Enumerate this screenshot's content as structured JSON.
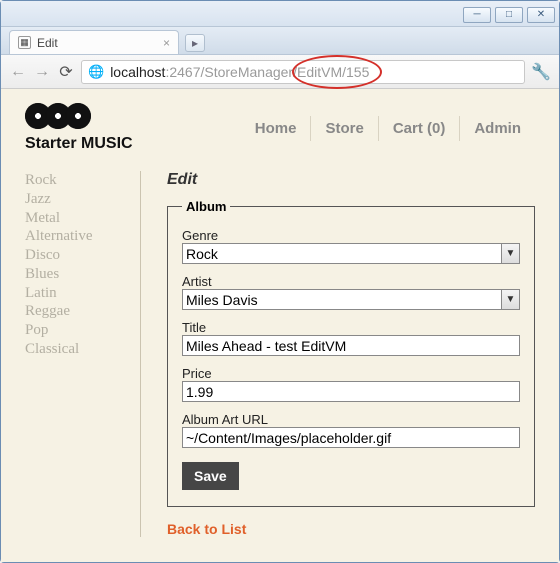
{
  "window": {
    "tab_title": "Edit",
    "url_host": "localhost",
    "url_rest": ":2467/StoreManager/EditVM/155"
  },
  "brand": "Starter MUSIC",
  "topnav": {
    "home": "Home",
    "store": "Store",
    "cart": "Cart (0)",
    "admin": "Admin"
  },
  "sidebar": {
    "genres": [
      "Rock",
      "Jazz",
      "Metal",
      "Alternative",
      "Disco",
      "Blues",
      "Latin",
      "Reggae",
      "Pop",
      "Classical"
    ]
  },
  "page": {
    "title": "Edit",
    "back_link": "Back to List"
  },
  "form": {
    "legend": "Album",
    "genre_label": "Genre",
    "genre_value": "Rock",
    "artist_label": "Artist",
    "artist_value": "Miles Davis",
    "title_label": "Title",
    "title_value": "Miles Ahead - test EditVM",
    "price_label": "Price",
    "price_value": "1.99",
    "art_label": "Album Art URL",
    "art_value": "~/Content/Images/placeholder.gif",
    "save_label": "Save"
  }
}
